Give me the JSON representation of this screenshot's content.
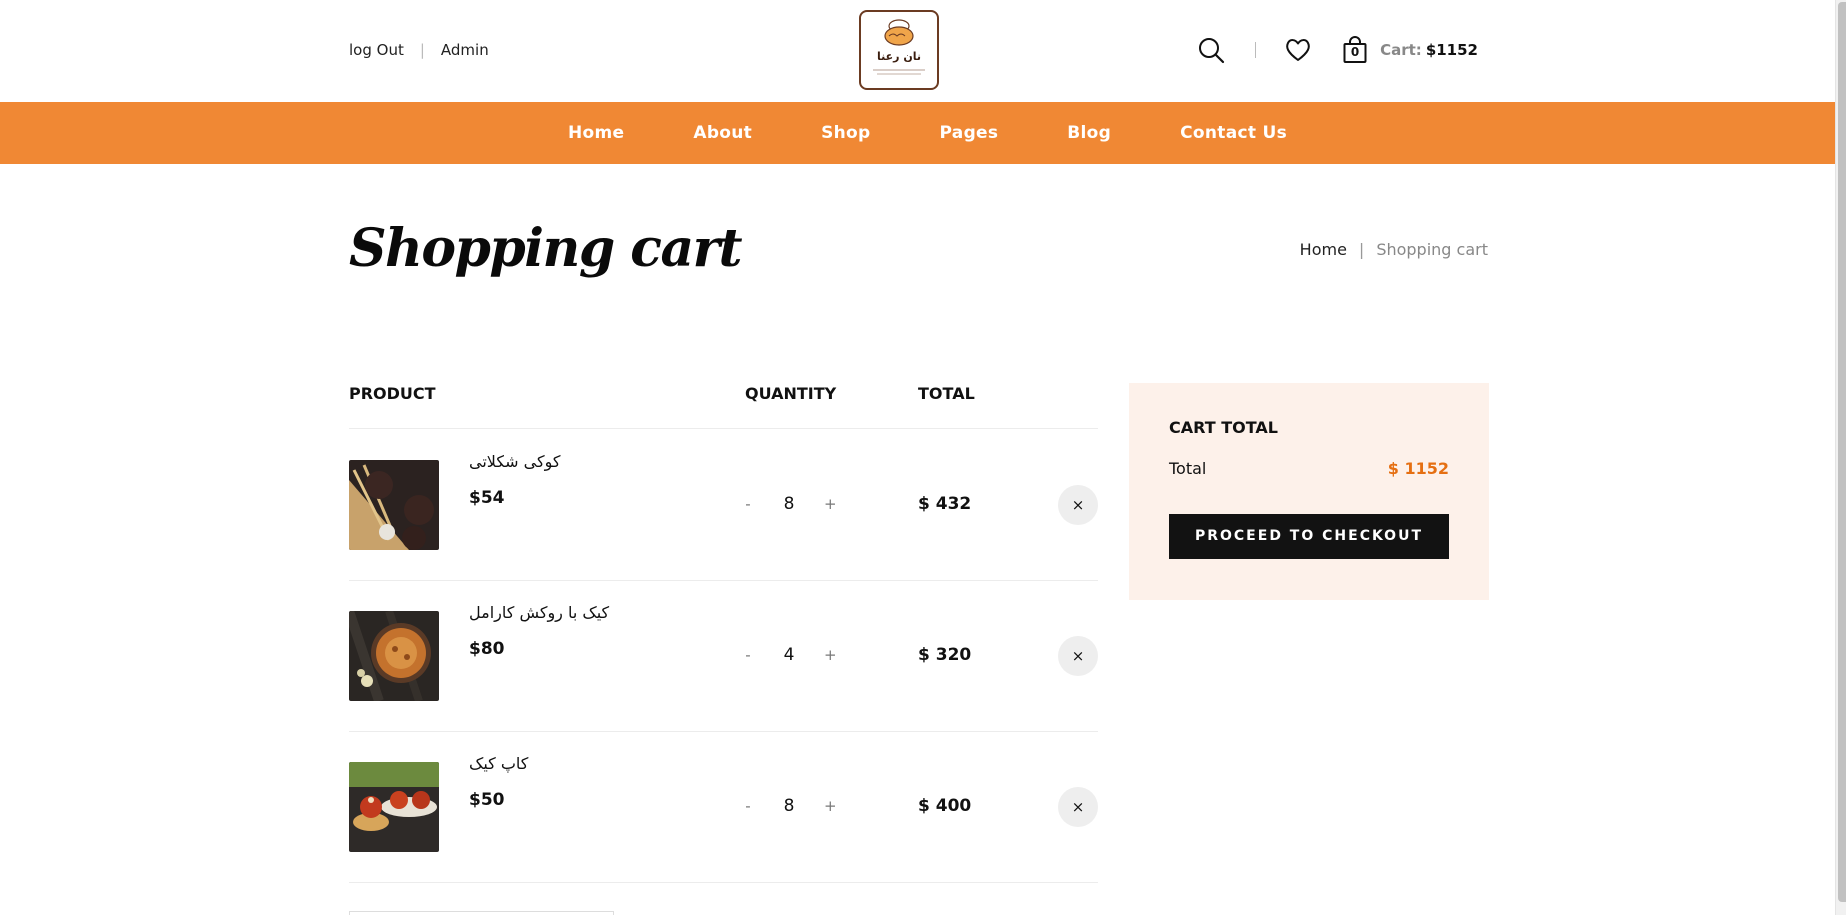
{
  "header": {
    "logout": "log Out",
    "admin": "Admin",
    "logo_text": "نان رعنا",
    "cart_label": "Cart:",
    "cart_amount": "$1152",
    "cart_count": "0",
    "icons": [
      "search-icon",
      "heart-icon",
      "shopping-bag-icon"
    ]
  },
  "nav": {
    "items": [
      "Home",
      "About",
      "Shop",
      "Pages",
      "Blog",
      "Contact Us"
    ]
  },
  "page": {
    "title": "Shopping cart",
    "breadcrumb_home": "Home",
    "breadcrumb_current": "Shopping cart"
  },
  "table": {
    "headers": {
      "product": "PRODUCT",
      "quantity": "QUANTITY",
      "total": "TOTAL"
    },
    "minus": "-",
    "plus": "+",
    "remove": "×",
    "rows": [
      {
        "name": "کوکی شکلاتی",
        "price": "$54",
        "qty": "8",
        "total": "$ 432"
      },
      {
        "name": "کیک با روکش کارامل",
        "price": "$80",
        "qty": "4",
        "total": "$ 320"
      },
      {
        "name": "کاپ کیک",
        "price": "$50",
        "qty": "8",
        "total": "$ 400"
      }
    ]
  },
  "summary": {
    "title": "CART TOTAL",
    "total_label": "Total",
    "total_value": "$ 1152",
    "checkout": "PROCEED TO CHECKOUT"
  },
  "colors": {
    "accent": "#f08834",
    "total_price": "#e56f12",
    "summary_bg": "#fdf1ea",
    "button_bg": "#121212"
  }
}
